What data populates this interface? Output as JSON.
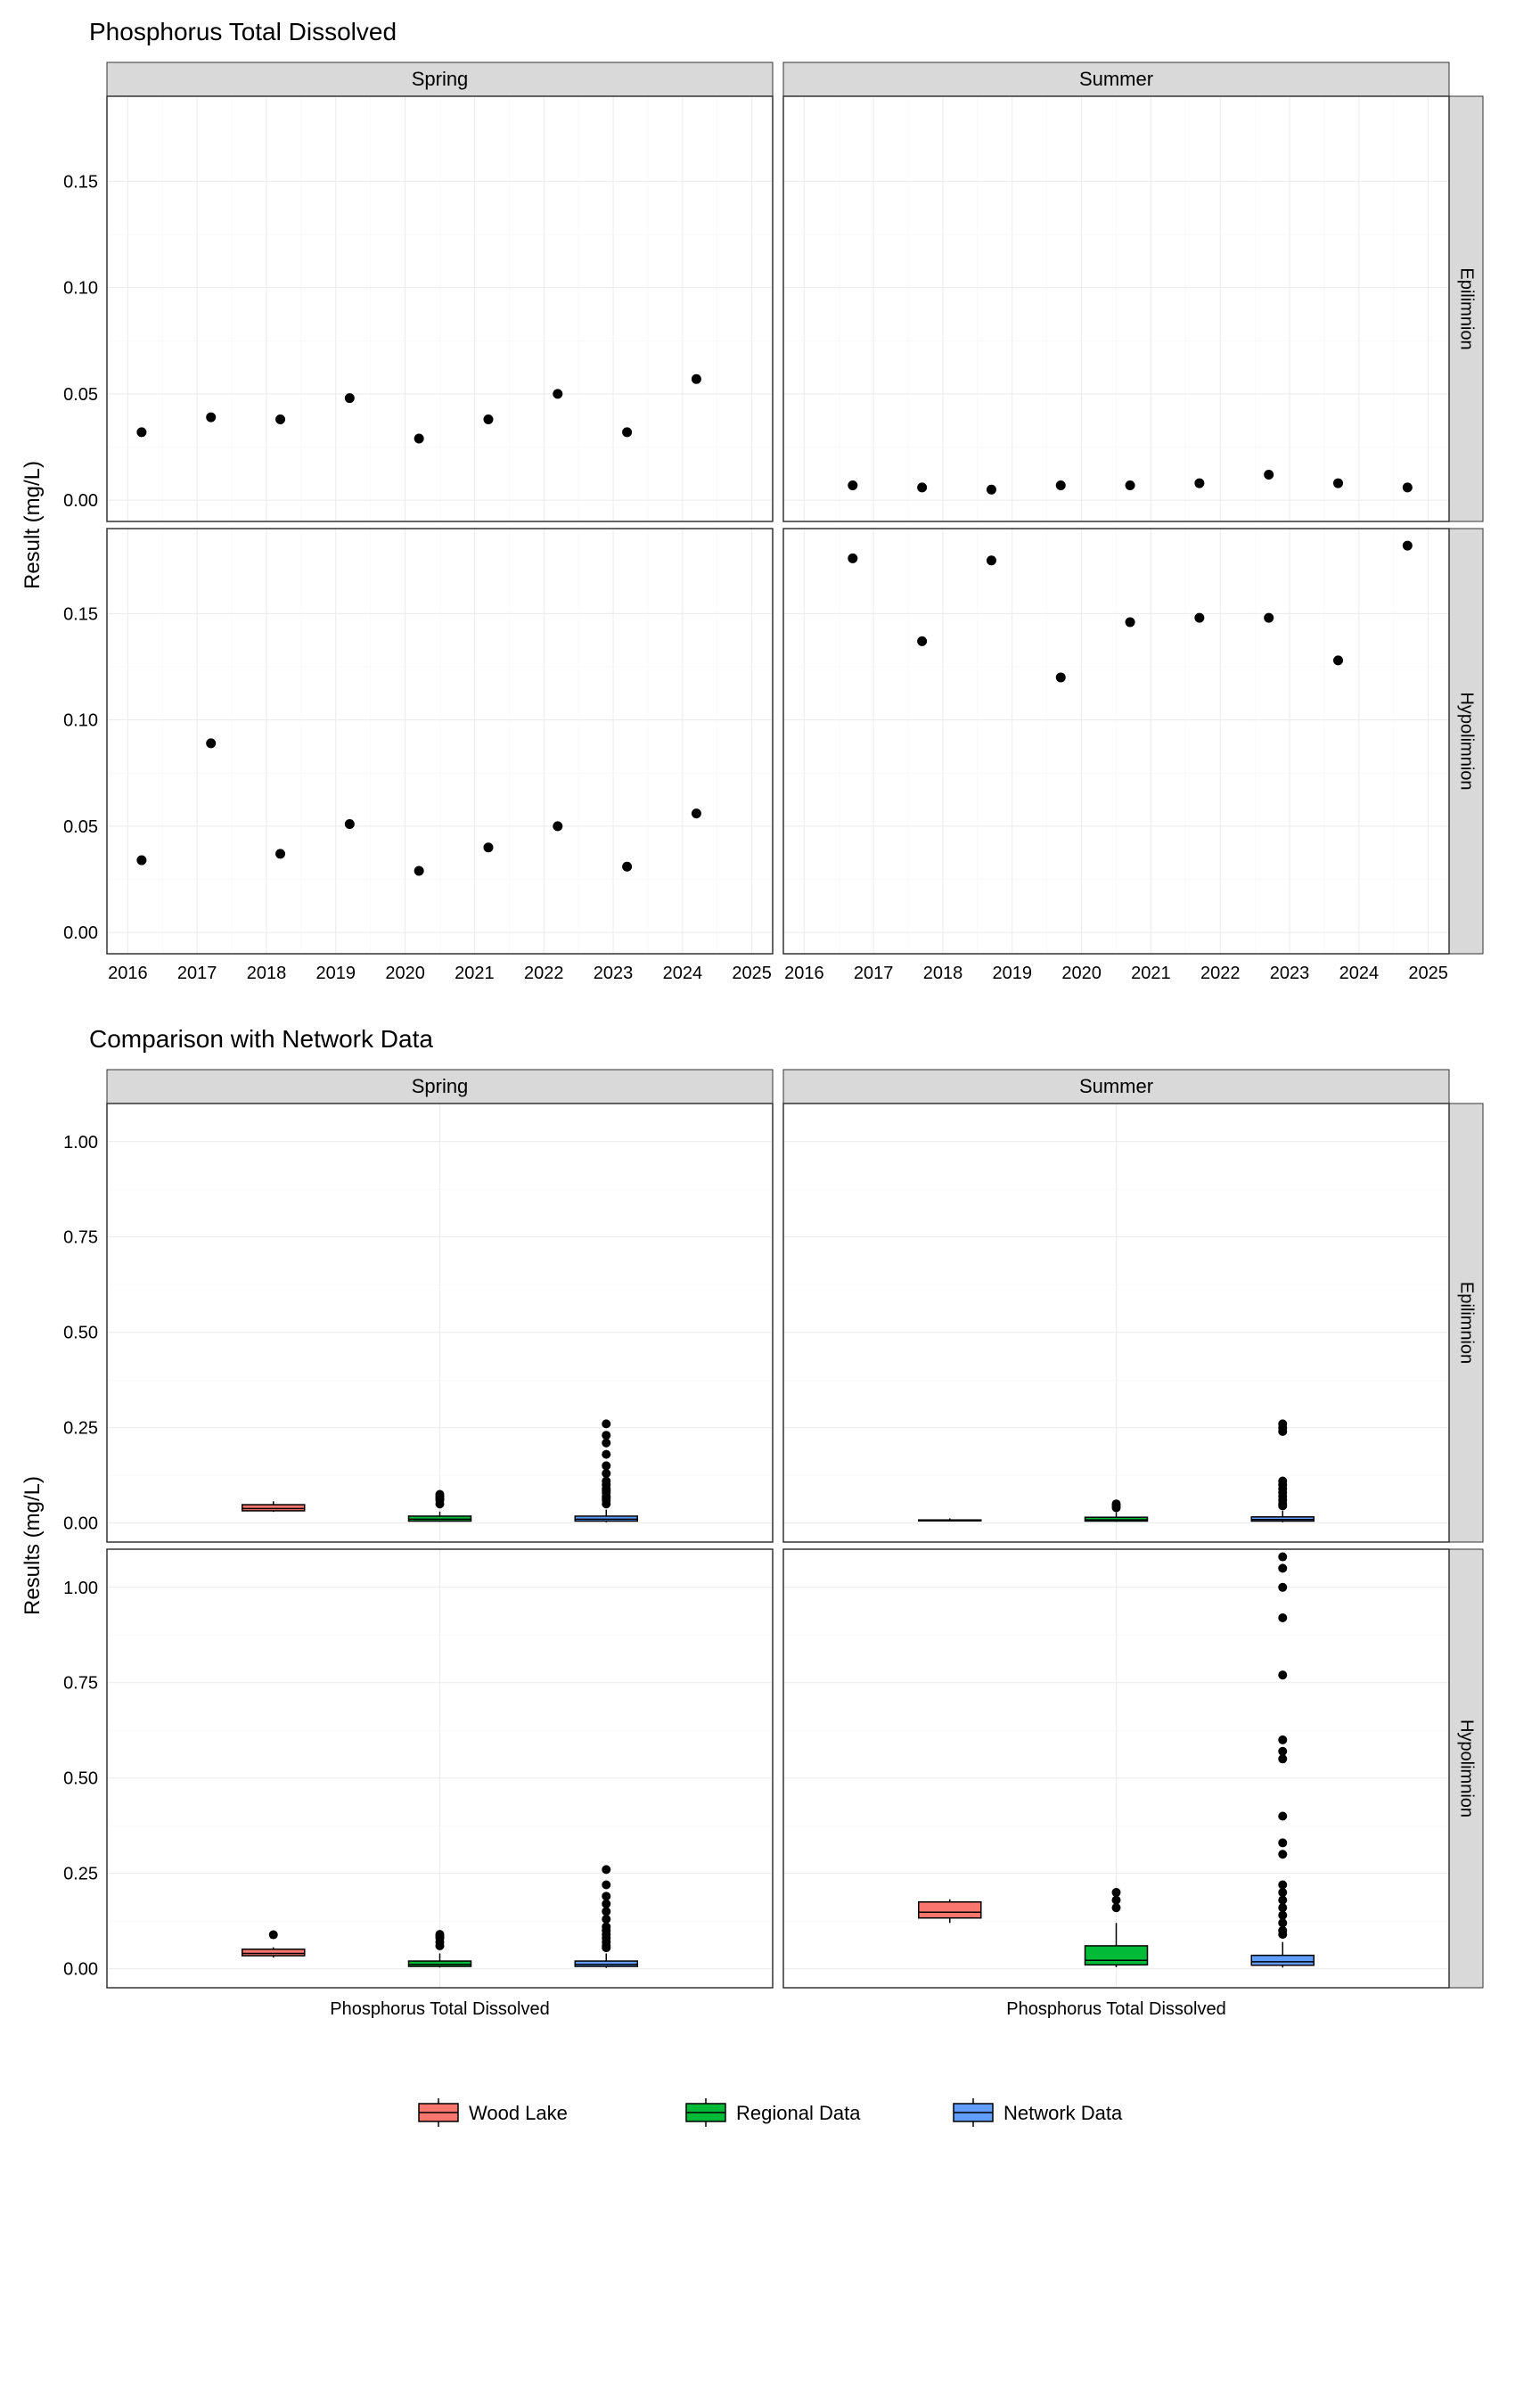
{
  "chart_data": [
    {
      "type": "scatter",
      "title": "Phosphorus Total Dissolved",
      "ylabel": "Result (mg/L)",
      "xlabel": "",
      "facet_cols": [
        "Spring",
        "Summer"
      ],
      "facet_rows": [
        "Epilimnion",
        "Hypolimnion"
      ],
      "x_ticks": [
        2016,
        2017,
        2018,
        2019,
        2020,
        2021,
        2022,
        2023,
        2024,
        2025
      ],
      "y_ticks": [
        0.0,
        0.05,
        0.1,
        0.15
      ],
      "ylim": [
        -0.01,
        0.19
      ],
      "xlim": [
        2015.7,
        2025.3
      ],
      "panels": {
        "Spring_Epilimnion": [
          {
            "x": 2016.2,
            "y": 0.032
          },
          {
            "x": 2017.2,
            "y": 0.039
          },
          {
            "x": 2018.2,
            "y": 0.038
          },
          {
            "x": 2019.2,
            "y": 0.048
          },
          {
            "x": 2020.2,
            "y": 0.029
          },
          {
            "x": 2021.2,
            "y": 0.038
          },
          {
            "x": 2022.2,
            "y": 0.05
          },
          {
            "x": 2023.2,
            "y": 0.032
          },
          {
            "x": 2024.2,
            "y": 0.057
          }
        ],
        "Summer_Epilimnion": [
          {
            "x": 2016.7,
            "y": 0.007
          },
          {
            "x": 2017.7,
            "y": 0.006
          },
          {
            "x": 2018.7,
            "y": 0.005
          },
          {
            "x": 2019.7,
            "y": 0.007
          },
          {
            "x": 2020.7,
            "y": 0.007
          },
          {
            "x": 2021.7,
            "y": 0.008
          },
          {
            "x": 2022.7,
            "y": 0.012
          },
          {
            "x": 2023.7,
            "y": 0.008
          },
          {
            "x": 2024.7,
            "y": 0.006
          }
        ],
        "Spring_Hypolimnion": [
          {
            "x": 2016.2,
            "y": 0.034
          },
          {
            "x": 2017.2,
            "y": 0.089
          },
          {
            "x": 2018.2,
            "y": 0.037
          },
          {
            "x": 2019.2,
            "y": 0.051
          },
          {
            "x": 2020.2,
            "y": 0.029
          },
          {
            "x": 2021.2,
            "y": 0.04
          },
          {
            "x": 2022.2,
            "y": 0.05
          },
          {
            "x": 2023.2,
            "y": 0.031
          },
          {
            "x": 2024.2,
            "y": 0.056
          }
        ],
        "Summer_Hypolimnion": [
          {
            "x": 2016.7,
            "y": 0.176
          },
          {
            "x": 2017.7,
            "y": 0.137
          },
          {
            "x": 2018.7,
            "y": 0.175
          },
          {
            "x": 2019.7,
            "y": 0.12
          },
          {
            "x": 2020.7,
            "y": 0.146
          },
          {
            "x": 2021.7,
            "y": 0.148
          },
          {
            "x": 2022.7,
            "y": 0.148
          },
          {
            "x": 2023.7,
            "y": 0.128
          },
          {
            "x": 2024.7,
            "y": 0.182
          }
        ]
      }
    },
    {
      "type": "box",
      "title": "Comparison with Network Data",
      "ylabel": "Results (mg/L)",
      "xlabel": "Phosphorus Total Dissolved",
      "facet_cols": [
        "Spring",
        "Summer"
      ],
      "facet_rows": [
        "Epilimnion",
        "Hypolimnion"
      ],
      "y_ticks": [
        0.0,
        0.25,
        0.5,
        0.75,
        1.0
      ],
      "ylim": [
        -0.05,
        1.1
      ],
      "series": [
        "Wood Lake",
        "Regional Data",
        "Network Data"
      ],
      "colors": {
        "Wood Lake": "#F8766D",
        "Regional Data": "#00BA38",
        "Network Data": "#619CFF"
      },
      "panels": {
        "Spring_Epilimnion": {
          "Wood Lake": {
            "min": 0.029,
            "q1": 0.032,
            "med": 0.038,
            "q3": 0.048,
            "max": 0.057,
            "outliers": []
          },
          "Regional Data": {
            "min": 0.003,
            "q1": 0.005,
            "med": 0.01,
            "q3": 0.018,
            "max": 0.03,
            "outliers": [
              0.05,
              0.06,
              0.07,
              0.075,
              0.065
            ]
          },
          "Network Data": {
            "min": 0.002,
            "q1": 0.005,
            "med": 0.01,
            "q3": 0.018,
            "max": 0.035,
            "outliers": [
              0.05,
              0.06,
              0.065,
              0.07,
              0.08,
              0.085,
              0.09,
              0.1,
              0.11,
              0.13,
              0.15,
              0.18,
              0.21,
              0.23,
              0.26
            ]
          }
        },
        "Summer_Epilimnion": {
          "Wood Lake": {
            "min": 0.005,
            "q1": 0.006,
            "med": 0.007,
            "q3": 0.008,
            "max": 0.012,
            "outliers": []
          },
          "Regional Data": {
            "min": 0.003,
            "q1": 0.005,
            "med": 0.008,
            "q3": 0.015,
            "max": 0.028,
            "outliers": [
              0.04,
              0.05,
              0.045
            ]
          },
          "Network Data": {
            "min": 0.002,
            "q1": 0.005,
            "med": 0.009,
            "q3": 0.016,
            "max": 0.032,
            "outliers": [
              0.045,
              0.05,
              0.06,
              0.07,
              0.08,
              0.09,
              0.1,
              0.11,
              0.24,
              0.25,
              0.26
            ]
          }
        },
        "Spring_Hypolimnion": {
          "Wood Lake": {
            "min": 0.029,
            "q1": 0.034,
            "med": 0.04,
            "q3": 0.051,
            "max": 0.056,
            "outliers": [
              0.089
            ]
          },
          "Regional Data": {
            "min": 0.003,
            "q1": 0.006,
            "med": 0.011,
            "q3": 0.02,
            "max": 0.04,
            "outliers": [
              0.06,
              0.07,
              0.08,
              0.085,
              0.09
            ]
          },
          "Network Data": {
            "min": 0.002,
            "q1": 0.006,
            "med": 0.011,
            "q3": 0.02,
            "max": 0.04,
            "outliers": [
              0.055,
              0.06,
              0.07,
              0.08,
              0.09,
              0.1,
              0.11,
              0.13,
              0.15,
              0.17,
              0.19,
              0.22,
              0.26
            ]
          }
        },
        "Summer_Hypolimnion": {
          "Wood Lake": {
            "min": 0.12,
            "q1": 0.133,
            "med": 0.148,
            "q3": 0.175,
            "max": 0.182,
            "outliers": []
          },
          "Regional Data": {
            "min": 0.004,
            "q1": 0.01,
            "med": 0.022,
            "q3": 0.06,
            "max": 0.12,
            "outliers": [
              0.16,
              0.18,
              0.2
            ]
          },
          "Network Data": {
            "min": 0.003,
            "q1": 0.009,
            "med": 0.018,
            "q3": 0.035,
            "max": 0.07,
            "outliers": [
              0.09,
              0.1,
              0.12,
              0.14,
              0.16,
              0.18,
              0.2,
              0.22,
              0.3,
              0.33,
              0.4,
              0.55,
              0.57,
              0.6,
              0.77,
              0.92,
              1.0,
              1.05,
              1.08
            ]
          }
        }
      }
    }
  ],
  "legend": {
    "items": [
      {
        "label": "Wood Lake",
        "color": "#F8766D"
      },
      {
        "label": "Regional Data",
        "color": "#00BA38"
      },
      {
        "label": "Network Data",
        "color": "#619CFF"
      }
    ]
  }
}
